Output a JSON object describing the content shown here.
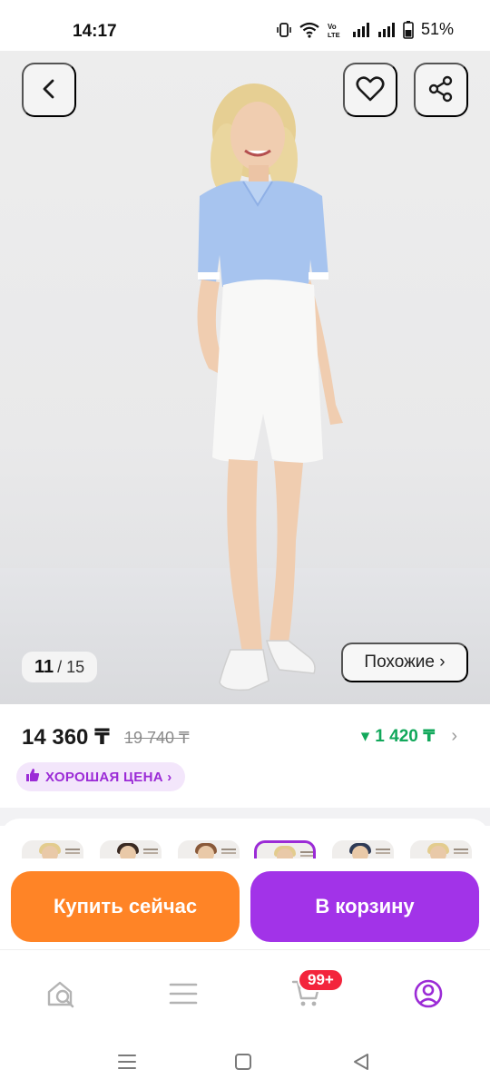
{
  "status_bar": {
    "time": "14:17",
    "battery_percent": "51%",
    "icons": [
      "vibrate-icon",
      "wifi-icon",
      "volte-icon",
      "signal-1-icon",
      "signal-2-icon",
      "battery-icon"
    ],
    "volte_label": "Vo LTE"
  },
  "gallery": {
    "current": "11",
    "total": "/ 15",
    "similar_label": "Похожие ›",
    "back_icon": "chevron-left-icon",
    "favorite_icon": "heart-icon",
    "share_icon": "share-icon"
  },
  "price": {
    "current": "14 360 ₸",
    "old": "19 740 ₸",
    "bonus": "1 420 ₸",
    "bonus_arrow": "▾",
    "bonus_chevron": "›",
    "good_price_label": "ХОРОШАЯ ЦЕНА ›",
    "bonus_color": "#12a85b",
    "good_price_color": "#9b2bd6"
  },
  "variants": {
    "count": 6,
    "selected_index": 3
  },
  "actions": {
    "buy_now_label": "Купить сейчас",
    "add_to_cart_label": "В корзину",
    "buy_now_color": "#ff8426",
    "add_to_cart_color": "#a233e8"
  },
  "bottom_nav": {
    "items": [
      {
        "name": "home-search",
        "icon": "home-search-icon"
      },
      {
        "name": "catalog",
        "icon": "menu-icon"
      },
      {
        "name": "cart",
        "icon": "cart-icon"
      },
      {
        "name": "profile",
        "icon": "profile-icon"
      }
    ],
    "cart_badge": "99+",
    "active_color": "#9b2bd6"
  },
  "system_nav": {
    "icons": [
      "recent-apps-icon",
      "home-icon",
      "back-icon"
    ]
  }
}
